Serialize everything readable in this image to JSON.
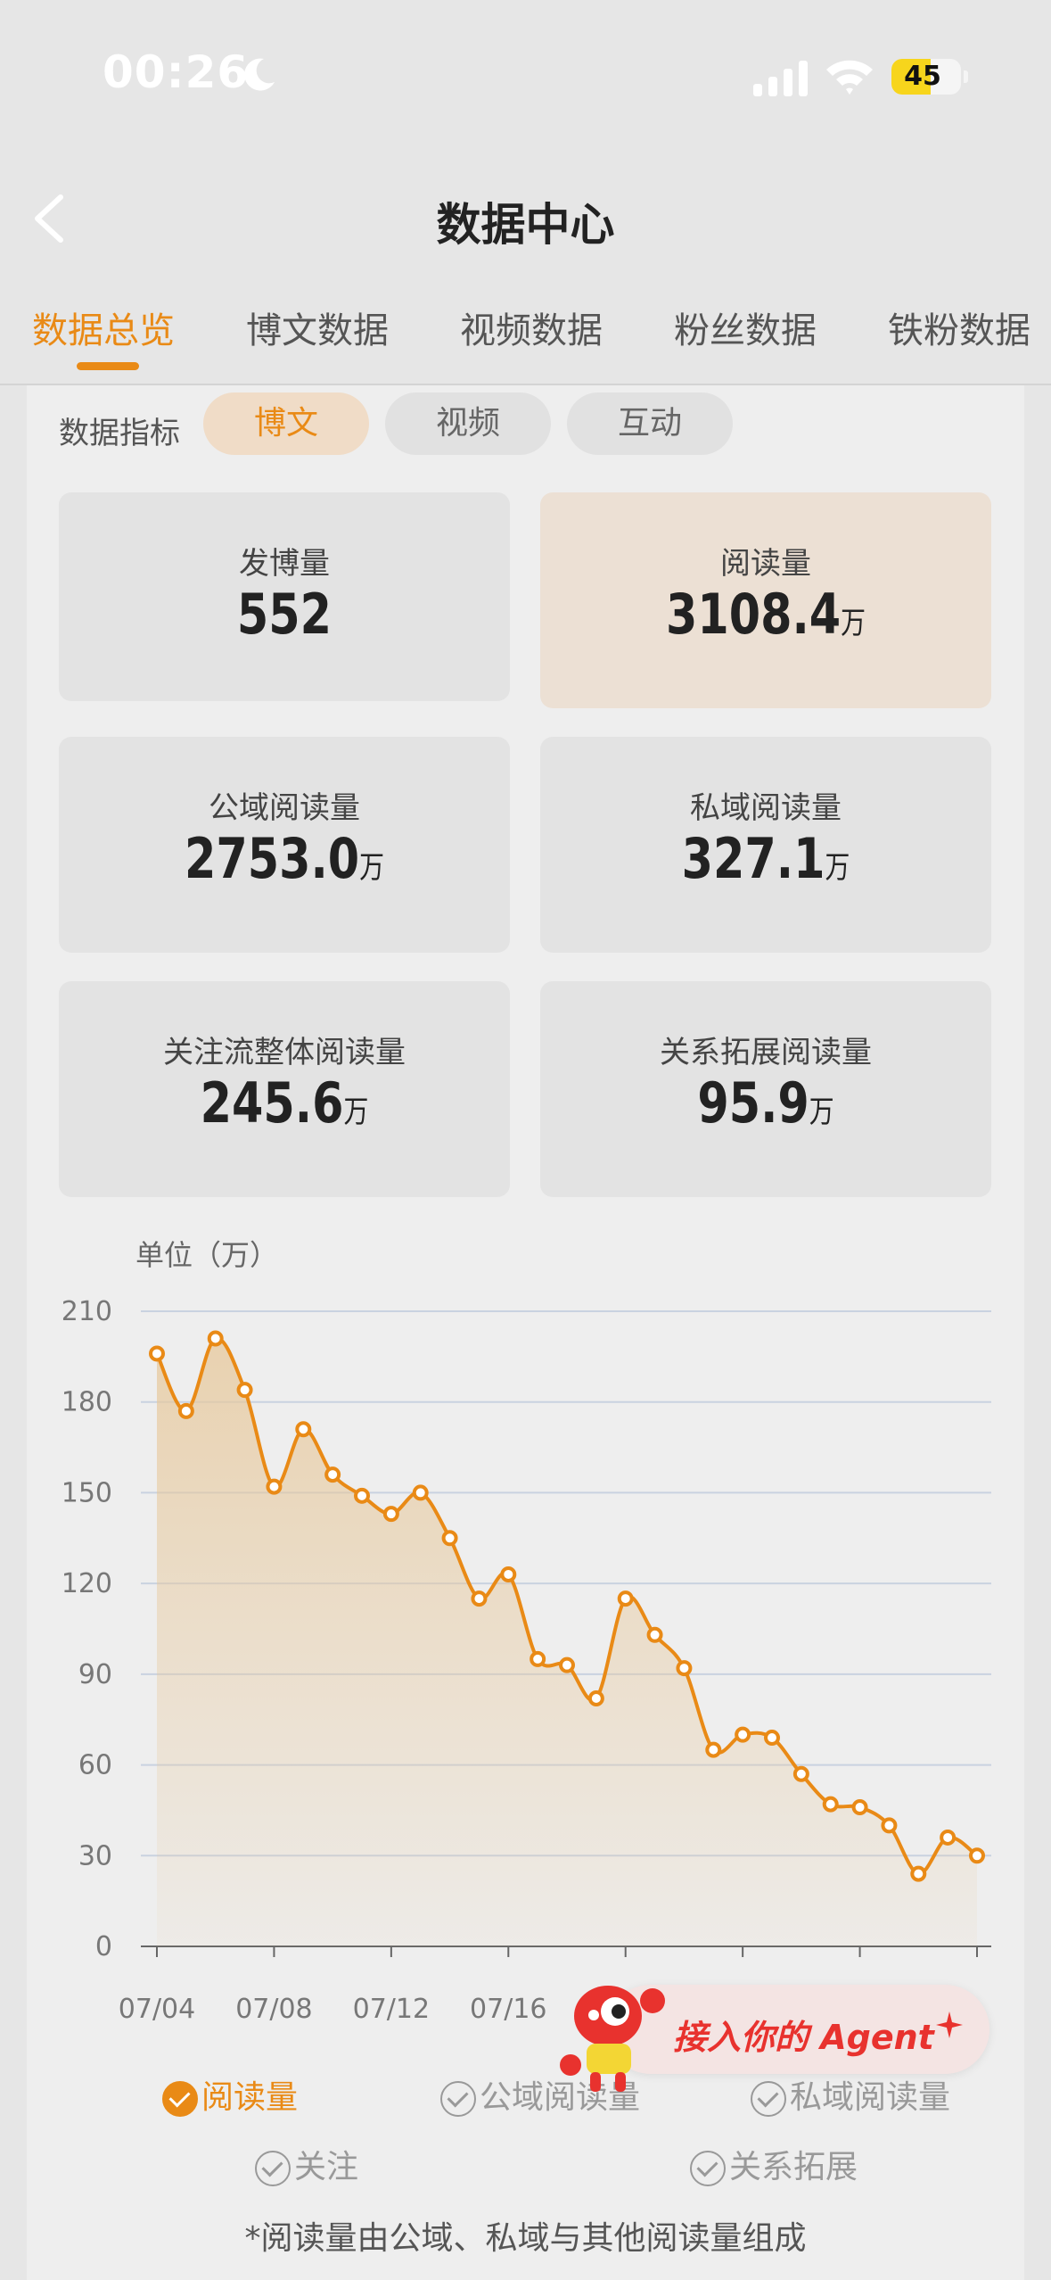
{
  "status": {
    "time": "00:26",
    "battery": "45"
  },
  "nav": {
    "title": "数据中心"
  },
  "tabs": [
    {
      "label": "数据总览",
      "active": true
    },
    {
      "label": "博文数据"
    },
    {
      "label": "视频数据"
    },
    {
      "label": "粉丝数据"
    },
    {
      "label": "铁粉数据"
    }
  ],
  "metric_filter": {
    "label": "数据指标",
    "chips": [
      {
        "label": "博文",
        "active": true
      },
      {
        "label": "视频"
      },
      {
        "label": "互动"
      }
    ]
  },
  "cards": [
    {
      "label": "发博量",
      "value": "552",
      "unit": ""
    },
    {
      "label": "阅读量",
      "value": "3108.4",
      "unit": "万",
      "active": true
    },
    {
      "label": "公域阅读量",
      "value": "2753.0",
      "unit": "万"
    },
    {
      "label": "私域阅读量",
      "value": "327.1",
      "unit": "万"
    },
    {
      "label": "关注流整体阅读量",
      "value": "245.6",
      "unit": "万"
    },
    {
      "label": "关系拓展阅读量",
      "value": "95.9",
      "unit": "万"
    }
  ],
  "chart_data": {
    "type": "area",
    "unit_label": "单位（万）",
    "ylim": [
      0,
      210
    ],
    "yticks": [
      "0",
      "30",
      "60",
      "90",
      "120",
      "150",
      "180",
      "210"
    ],
    "xtick_labels": [
      "07/04",
      "07/08",
      "07/12",
      "07/16"
    ],
    "x": [
      "07/04",
      "07/05",
      "07/06",
      "07/07",
      "07/08",
      "07/09",
      "07/10",
      "07/11",
      "07/12",
      "07/13",
      "07/14",
      "07/15",
      "07/16",
      "07/17",
      "07/18",
      "07/19",
      "07/20",
      "07/21",
      "07/22",
      "07/23",
      "07/24",
      "07/25",
      "07/26",
      "07/27",
      "07/28",
      "07/29",
      "07/30",
      "07/31",
      "08/01"
    ],
    "series": [
      {
        "name": "阅读量",
        "color": "#e98a16",
        "values": [
          196,
          177,
          201,
          184,
          152,
          171,
          156,
          149,
          143,
          150,
          135,
          115,
          123,
          95,
          93,
          82,
          115,
          103,
          92,
          65,
          70,
          69,
          57,
          47,
          46,
          40,
          24,
          36,
          30
        ]
      }
    ],
    "grid": true
  },
  "legend": [
    {
      "label": "阅读量",
      "checked": true
    },
    {
      "label": "公域阅读量",
      "checked": false
    },
    {
      "label": "私域阅读量",
      "checked": false
    },
    {
      "label": "关注",
      "checked": false
    },
    {
      "label": "关系拓展",
      "checked": false
    }
  ],
  "footnote": "*阅读量由公域、私域与其他阅读量组成",
  "agent": {
    "label": "接入你的 Agent"
  }
}
